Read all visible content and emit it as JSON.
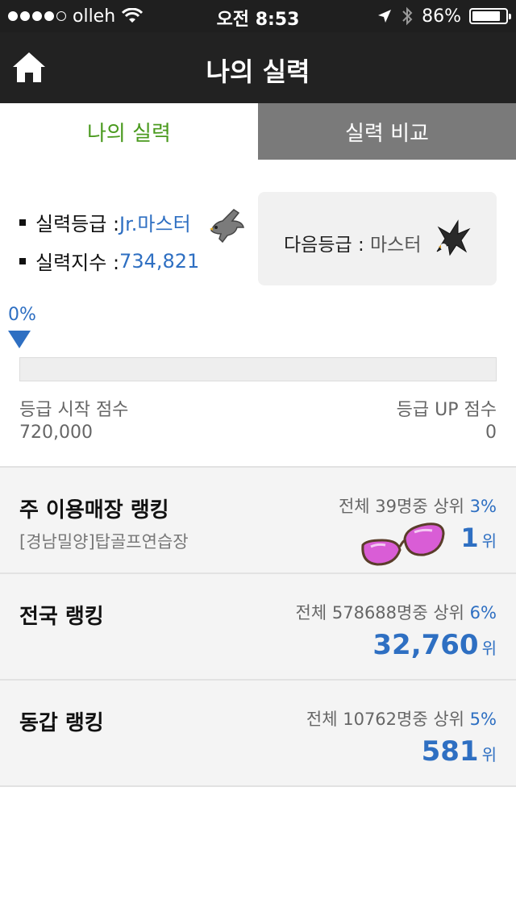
{
  "status_bar": {
    "carrier": "olleh",
    "time": "오전 8:53",
    "battery": "86%",
    "battery_level": 0.86
  },
  "nav": {
    "title": "나의 실력"
  },
  "tabs": [
    {
      "label": "나의 실력"
    },
    {
      "label": "실력 비교"
    }
  ],
  "skill": {
    "grade_label": "실력등급 : ",
    "grade_value": "Jr.마스터",
    "index_label": "실력지수 : ",
    "index_value": "734,821",
    "next_label": "다음등급 : ",
    "next_value": "마스터"
  },
  "progress": {
    "percent_text": "0%",
    "percent": 0,
    "start_label": "등급 시작 점수",
    "start_value": "720,000",
    "up_label": "등급 UP 점수",
    "up_value": "0"
  },
  "rankings": [
    {
      "title": "주 이용매장 랭킹",
      "subtitle": "[경남밀양]탑골프연습장",
      "info": "전체 39명중 상위",
      "percent": "3%",
      "value": "1",
      "unit": "위"
    },
    {
      "title": "전국 랭킹",
      "info": "전체 578688명중 상위",
      "percent": "6%",
      "value": "32,760",
      "unit": "위"
    },
    {
      "title": "동갑 랭킹",
      "info": "전체 10762명중 상위",
      "percent": "5%",
      "value": "581",
      "unit": "위"
    }
  ]
}
